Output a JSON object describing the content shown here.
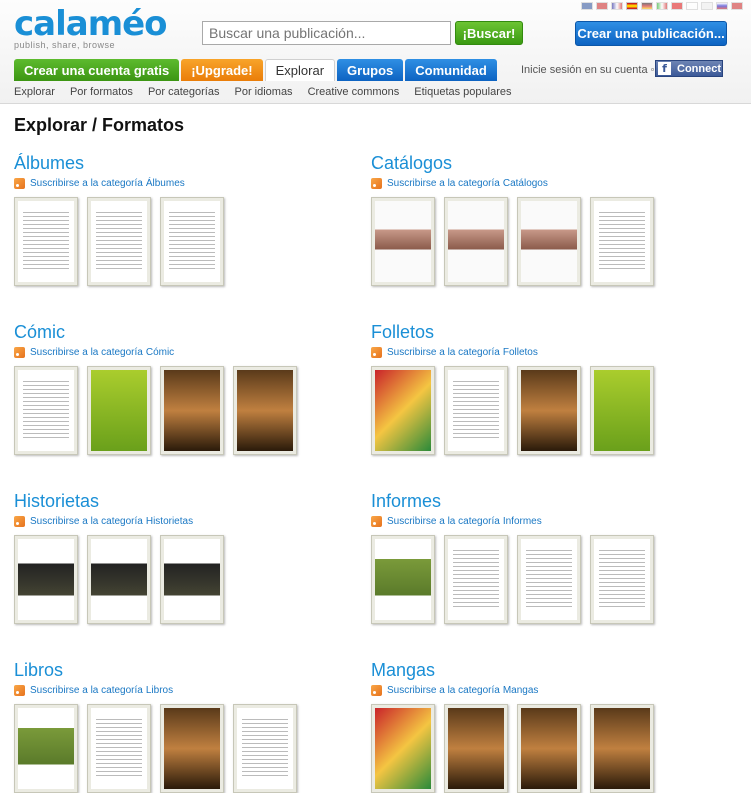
{
  "brand": {
    "name": "calaméo",
    "tagline": "publish, share, browse"
  },
  "search": {
    "placeholder": "Buscar una publicación...",
    "button": "¡Buscar!"
  },
  "create_publication": "Crear una publicación...",
  "nav": {
    "tabs": [
      {
        "label": "Crear una cuenta gratis",
        "style": "green"
      },
      {
        "label": "¡Upgrade!",
        "style": "orange"
      },
      {
        "label": "Explorar",
        "style": "active"
      },
      {
        "label": "Grupos",
        "style": "blue"
      },
      {
        "label": "Comunidad",
        "style": "blue"
      }
    ],
    "login": "Inicie sesión en su cuenta ◦",
    "connect": "Connect"
  },
  "subnav": [
    "Explorar",
    "Por formatos",
    "Por categorías",
    "Por idiomas",
    "Creative commons",
    "Etiquetas populares"
  ],
  "page_title": "Explorar / Formatos",
  "subscribe_prefix": "Suscribirse a la categoría",
  "categories": [
    {
      "title": "Álbumes",
      "thumbs": [
        "doc",
        "doc",
        "doc"
      ]
    },
    {
      "title": "Catálogos",
      "thumbs": [
        "pic-beauty",
        "pic-beauty",
        "pic-beauty",
        "doc"
      ]
    },
    {
      "title": "Cómic",
      "thumbs": [
        "doc",
        "pic-bio",
        "pic-dark",
        "pic-dark"
      ]
    },
    {
      "title": "Folletos",
      "thumbs": [
        "pic-color",
        "doc",
        "pic-dark",
        "pic-bio"
      ]
    },
    {
      "title": "Historietas",
      "thumbs": [
        "pic-space",
        "pic-space",
        "pic-space"
      ]
    },
    {
      "title": "Informes",
      "thumbs": [
        "pic-green",
        "doc",
        "doc",
        "doc"
      ]
    },
    {
      "title": "Libros",
      "thumbs": [
        "pic-green",
        "doc",
        "pic-dark",
        "doc"
      ]
    },
    {
      "title": "Mangas",
      "thumbs": [
        "pic-color",
        "pic-dark",
        "pic-dark",
        "pic-dark"
      ]
    }
  ],
  "colors": {
    "brand_blue": "#1a8fd6",
    "green": "#3c9513",
    "orange": "#ea7d09"
  }
}
